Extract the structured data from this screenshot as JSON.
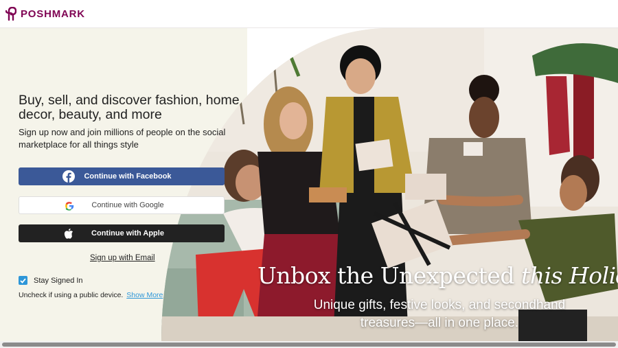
{
  "header": {
    "brand_name": "POSHMARK",
    "logo_icon": "poshmark-logo-icon",
    "brand_color": "#7f0353"
  },
  "signup": {
    "headline": "Buy, sell, and discover fashion, home decor, beauty, and more",
    "subtext": "Sign up now and join millions of people on the social marketplace for all things style",
    "facebook_label": "Continue with Facebook",
    "google_label": "Continue with Google",
    "apple_label": "Continue with Apple",
    "email_link": "Sign up with Email",
    "stay_signed_in_label": "Stay Signed In",
    "stay_signed_in_checked": true,
    "public_device_hint": "Uncheck if using a public device.",
    "show_more_link": "Show More"
  },
  "promo": {
    "title_main": "Unbox the Unexpected ",
    "title_italic": "this Holida",
    "subtitle": "Unique gifts, festive looks, and secondhand treasures—all in one place."
  },
  "colors": {
    "facebook": "#3b5998",
    "apple": "#222222",
    "panel_bg": "#f5f4ea",
    "link_blue": "#2d96d8"
  }
}
